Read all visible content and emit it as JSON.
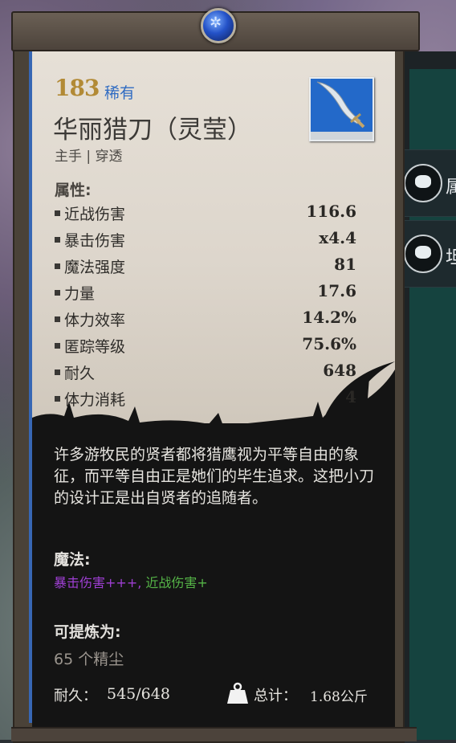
{
  "item": {
    "level": "183",
    "rarity": "稀有",
    "name": "华丽猎刀（灵莹）",
    "type": "主手 | 穿透",
    "icon": "curved-dagger-icon"
  },
  "attributes": {
    "heading": "属性:",
    "stats": [
      {
        "name": "近战伤害",
        "value": "116.6"
      },
      {
        "name": "暴击伤害",
        "value": "x4.4"
      },
      {
        "name": "魔法强度",
        "value": "81"
      },
      {
        "name": "力量",
        "value": "17.6"
      },
      {
        "name": "体力效率",
        "value": "14.2%"
      },
      {
        "name": "匿踪等级",
        "value": "75.6%"
      },
      {
        "name": "耐久",
        "value": "648"
      },
      {
        "name": "体力消耗",
        "value": "4"
      }
    ]
  },
  "description": "许多游牧民的贤者都将猎鹰视为平等自由的象征，而平等自由正是她们的毕生追求。这把小刀的设计正是出自贤者的追随者。",
  "magic": {
    "heading": "魔法:",
    "effect_1": "暴击伤害+++,",
    "effect_2": " 近战伤害+"
  },
  "refine": {
    "heading": "可提炼为:",
    "value": "65 个精尘"
  },
  "footer": {
    "durability_label": "耐久：",
    "durability_value": "545/648",
    "weight_label": "总计：",
    "weight_value": "1.68公斤"
  },
  "side_panel": {
    "item_1_glyph": "属",
    "item_2_glyph": "坦"
  },
  "colors": {
    "level": "#b28a35",
    "rarity": "#2f6bc2",
    "magic_purple": "#9f3fd4",
    "magic_green": "#55b447"
  }
}
